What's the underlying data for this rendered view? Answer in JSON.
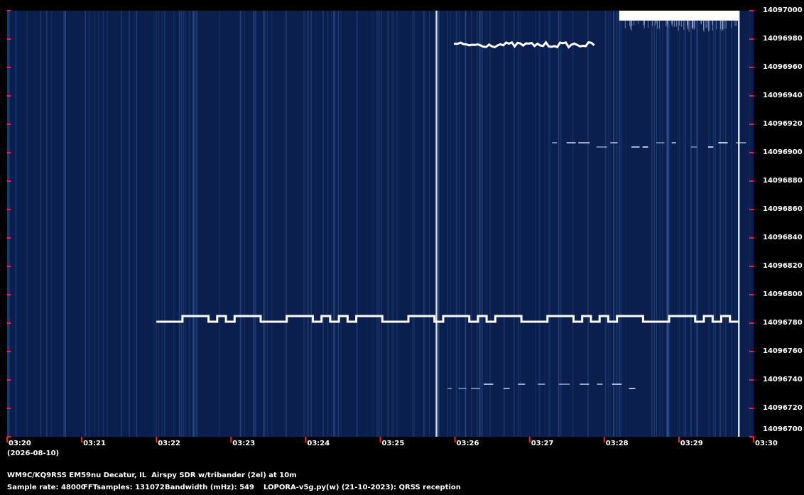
{
  "chart_data": {
    "type": "heatmap",
    "subtype": "QRSS spectrogram (waterfall)",
    "x_axis": {
      "ticks": [
        "03:20",
        "03:21",
        "03:22",
        "03:23",
        "03:24",
        "03:25",
        "03:26",
        "03:27",
        "03:28",
        "03:29",
        "03:30"
      ],
      "range": [
        "03:20",
        "03:30"
      ],
      "date": "(2026-08-10)"
    },
    "y_axis": {
      "unit": "Hz",
      "range": [
        14096700,
        14097000
      ],
      "ticks": [
        "14097000",
        "14096980",
        "14096960",
        "14096940",
        "14096920",
        "14096900",
        "14096880",
        "14096860",
        "14096840",
        "14096820",
        "14096800",
        "14096780",
        "14096760",
        "14096740",
        "14096720",
        "14096700"
      ],
      "minor_tick_color": "#ff2020"
    },
    "colors": {
      "background": "#0a1f4e",
      "signal": "#ffffff",
      "tick": "#ff2020"
    },
    "signals": [
      {
        "kind": "fsk-trace",
        "t_start": "03:22.0",
        "t_end": "03:29.8",
        "base_hz": 14096781,
        "high_hz": 14096785
      },
      {
        "kind": "broadband-band",
        "t_start": "03:28.2",
        "t_end": "03:29.8",
        "hz_low": 14096993,
        "hz_high": 14097000
      },
      {
        "kind": "noisy-trace",
        "t_start": "03:26.0",
        "t_end": "03:27.9",
        "hz": 14096976
      },
      {
        "kind": "faint-trace",
        "t_start": "03:27.3",
        "t_end": "03:29.8",
        "hz": 14096906
      },
      {
        "kind": "faint-trace",
        "t_start": "03:25.9",
        "t_end": "03:28.5",
        "hz": 14096736
      },
      {
        "kind": "vertical-spike",
        "t": "03:25.75"
      },
      {
        "kind": "vertical-spike",
        "t": "03:29.8"
      }
    ]
  },
  "footer": {
    "station": "WM9C/KQ9RSS EM59nu Decatur, IL  Airspy SDR w/tribander (2el) at 10m",
    "sample_rate": "Sample rate: 48000",
    "fft_samples": "FFTsamples: 131072",
    "bandwidth": "Bandwidth (mHz): 549",
    "software": "LOPORA-v5g.py(w) (21-10-2023): QRSS reception"
  }
}
